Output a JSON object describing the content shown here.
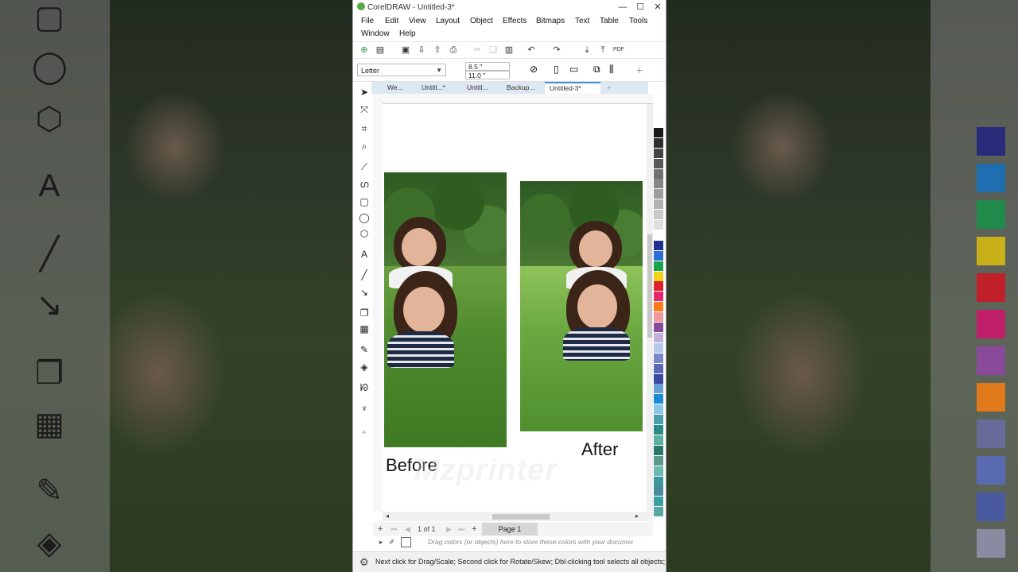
{
  "window": {
    "title": "CorelDRAW - Untitled-3*",
    "minimize": "—",
    "maximize": "☐",
    "close": "✕"
  },
  "menu": {
    "file": "File",
    "edit": "Edit",
    "view": "View",
    "layout": "Layout",
    "object": "Object",
    "effects": "Effects",
    "bitmaps": "Bitmaps",
    "text": "Text",
    "table": "Table",
    "tools": "Tools",
    "window": "Window",
    "help": "Help"
  },
  "propbar": {
    "paper": "Letter",
    "width": "8.5 \"",
    "height": "11.0 \""
  },
  "tabs": [
    "We...",
    "Untitl...*",
    "Untitl...",
    "Backup...",
    "Untitled-3*"
  ],
  "canvas": {
    "before_label": "Before",
    "after_label": "After",
    "watermark": "Mzprinter"
  },
  "pagebar": {
    "page_count": "1 of 1",
    "page_tab": "Page 1"
  },
  "doc_palette_hint": "Drag colors (or objects) here to store these colors with your document",
  "status": "Next click for Drag/Scale; Second click for Rotate/Skew; Dbl-clicking tool selects all objects; Shif",
  "palette_colors": [
    "#ffffff",
    "#1a1a1a",
    "#2e2e2e",
    "#444444",
    "#5a5a5a",
    "#707070",
    "#868686",
    "#9c9c9c",
    "#b2b2b2",
    "#c8c8c8",
    "#dedede",
    "#ffffff",
    "#1f2f8f",
    "#2a6fd6",
    "#1aa34a",
    "#f2d21a",
    "#e0202a",
    "#e8246a",
    "#ff7a1a",
    "#f09aa0",
    "#8a4a9a",
    "#c2b0d8",
    "#b8c8e8",
    "#7888c8",
    "#5a6ab8",
    "#3a4aa0",
    "#6aa0d8",
    "#1a8ad8",
    "#8ac8e8",
    "#4aa0a8",
    "#2a8a8a",
    "#58b0a0",
    "#2a7a6a",
    "#5a9a8a",
    "#6ab8b0",
    "#3a9a9a",
    "#4a8a9a",
    "#3aa0a0",
    "#58a8a8"
  ],
  "bg_swatches": [
    "#2a2a7a",
    "#1f6fb0",
    "#1f8a4a",
    "#c8b01a",
    "#c0202a",
    "#c0206a",
    "#8a4a9a",
    "#e07a1a",
    "#6a6a9a",
    "#5a6ab0",
    "#4a5aa0",
    "#8a8aa0"
  ]
}
